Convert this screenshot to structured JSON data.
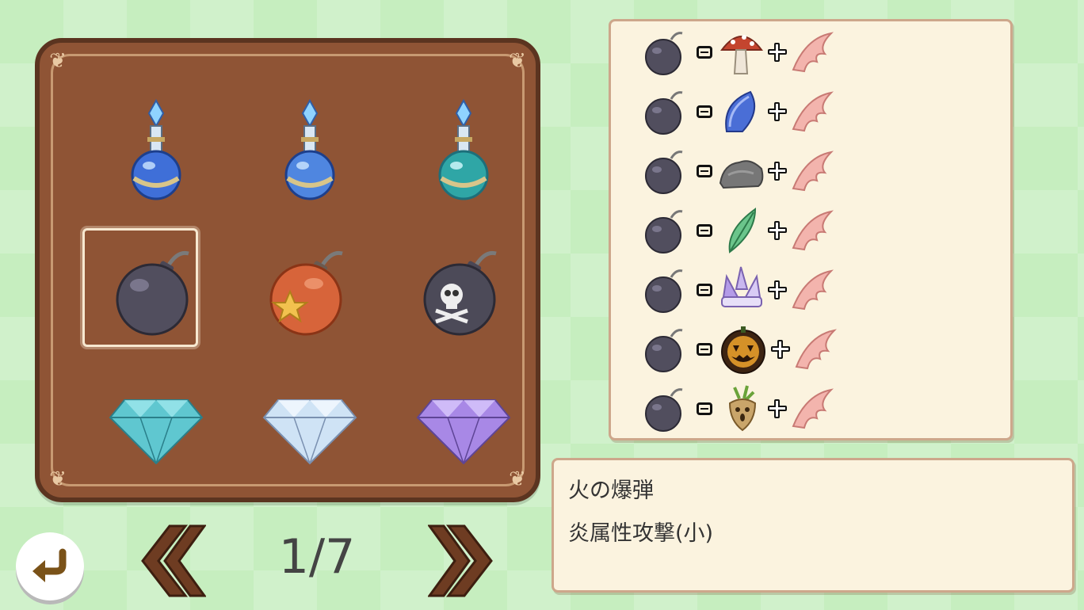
{
  "items": [
    {
      "name": "blue-potion-icon",
      "color": "#3f6fd8"
    },
    {
      "name": "blue-potion-icon",
      "color": "#4f86e0"
    },
    {
      "name": "teal-potion-icon",
      "color": "#2fa6a6"
    },
    {
      "name": "bomb-icon",
      "color": "#514e5e"
    },
    {
      "name": "star-bomb-icon",
      "color": "#d7643a"
    },
    {
      "name": "skull-bomb-icon",
      "color": "#4c4a58"
    },
    {
      "name": "cyan-gem-icon",
      "color": "#5fc7d0"
    },
    {
      "name": "white-gem-icon",
      "color": "#cfe3f5"
    },
    {
      "name": "purple-gem-icon",
      "color": "#a888e6"
    }
  ],
  "selected_index": 3,
  "recipes": [
    {
      "result": "bomb-icon",
      "ingredient": "mushroom-icon",
      "extra": "claw-icon"
    },
    {
      "result": "bomb-icon",
      "ingredient": "blue-shell-icon",
      "extra": "claw-icon"
    },
    {
      "result": "bomb-icon",
      "ingredient": "rock-icon",
      "extra": "claw-icon"
    },
    {
      "result": "bomb-icon",
      "ingredient": "green-feather-icon",
      "extra": "claw-icon"
    },
    {
      "result": "bomb-icon",
      "ingredient": "crystal-icon",
      "extra": "claw-icon"
    },
    {
      "result": "bomb-icon",
      "ingredient": "pumpkin-icon",
      "extra": "claw-icon"
    },
    {
      "result": "bomb-icon",
      "ingredient": "mandrake-icon",
      "extra": "claw-icon"
    }
  ],
  "description": {
    "name": "火の爆弾",
    "effect": "炎属性攻撃(小)"
  },
  "pagination": {
    "page": "1/7"
  },
  "colors": {
    "panel_brown": "#8f5435",
    "paper": "#fbf3df",
    "background": "#c6eebf"
  }
}
